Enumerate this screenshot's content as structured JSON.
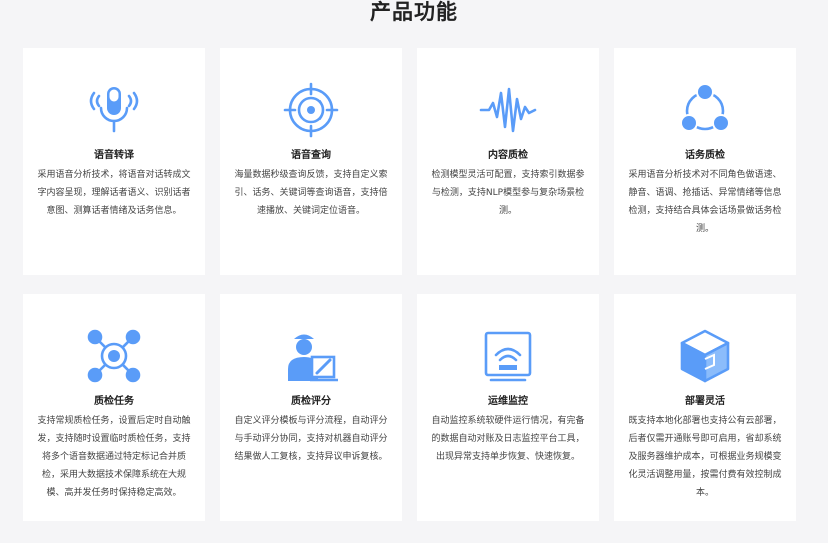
{
  "page": {
    "title": "产品功能"
  },
  "features": [
    {
      "name": "语音转译",
      "icon": "microphone-icon",
      "desc": "采用语音分析技术，将语音对话转成文字内容呈现，理解话者语义、识别话者意图、测算话者情绪及话务信息。"
    },
    {
      "name": "语音查询",
      "icon": "voice-search-icon",
      "desc": "海量数据秒级查询反馈，支持自定义索引、话务、关键词等查询语音，支持倍速播放、关键词定位语音。"
    },
    {
      "name": "内容质检",
      "icon": "waveform-icon",
      "desc": "检测模型灵活可配置，支持索引数据参与检测，支持NLP模型参与复杂场景检测。"
    },
    {
      "name": "话务质检",
      "icon": "share-nodes-icon",
      "desc": "采用语音分析技术对不同角色做语速、静音、语调、抢插话、异常情绪等信息检测，支持结合具体会话场景做话务检测。"
    },
    {
      "name": "质检任务",
      "icon": "network-hub-icon",
      "desc": "支持常规质检任务，设置后定时自动触发，支持随时设置临时质检任务，支持将多个语音数据通过特定标记合并质检，采用大数据技术保障系统在大规模、高并发任务时保持稳定高效。"
    },
    {
      "name": "质检评分",
      "icon": "reviewer-icon",
      "desc": "自定义评分模板与评分流程，自动评分与手动评分协同，支持对机器自动评分结果做人工复核，支持异议申诉复核。"
    },
    {
      "name": "运维监控",
      "icon": "monitor-signal-icon",
      "desc": "自动监控系统软硬件运行情况，有完备的数据自动对账及日志监控平台工具，出现异常支持单步恢复、快速恢复。"
    },
    {
      "name": "部署灵活",
      "icon": "cube-icon",
      "desc": "既支持本地化部署也支持公有云部署，后者仅需开通账号即可启用，省却系统及服务器维护成本，可根据业务规模变化灵活调整用量，按需付费有效控制成本。"
    }
  ],
  "colors": {
    "accent": "#5a9cf8",
    "background": "#f5f5f7",
    "card": "#ffffff"
  }
}
